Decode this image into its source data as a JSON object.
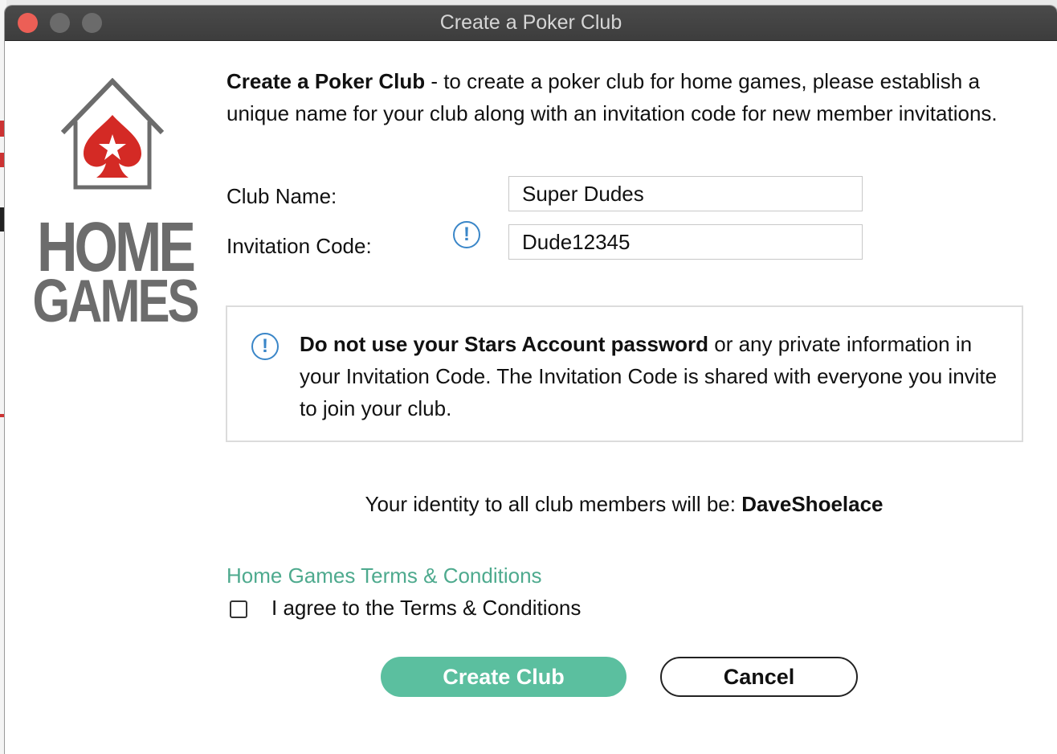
{
  "window": {
    "title": "Create a Poker Club"
  },
  "logo": {
    "line1": "HOME",
    "line2": "GAMES"
  },
  "intro": {
    "bold": "Create a Poker Club",
    "text": " - to create a poker club for home games, please establish a unique name for your club along with an invitation code for new member invitations."
  },
  "form": {
    "club_name_label": "Club Name:",
    "club_name_value": "Super Dudes",
    "invitation_code_label": "Invitation Code:",
    "invitation_code_value": "Dude12345",
    "info_glyph": "!"
  },
  "warning": {
    "bold": "Do not use your Stars Account password",
    "text": " or any private information in your Invitation Code. The Invitation Code is shared with everyone you invite to join your club."
  },
  "identity": {
    "prefix": "Your identity to all club members will be: ",
    "name": "DaveShoelace"
  },
  "terms": {
    "link_label": "Home Games Terms & Conditions",
    "checkbox_label": "I agree to the Terms & Conditions",
    "checked": false
  },
  "buttons": {
    "create_label": "Create Club",
    "cancel_label": "Cancel"
  },
  "colors": {
    "accent": "#5bbf9f",
    "link": "#4eaa8e",
    "info": "#3a86c8",
    "spade": "#d42a25"
  }
}
